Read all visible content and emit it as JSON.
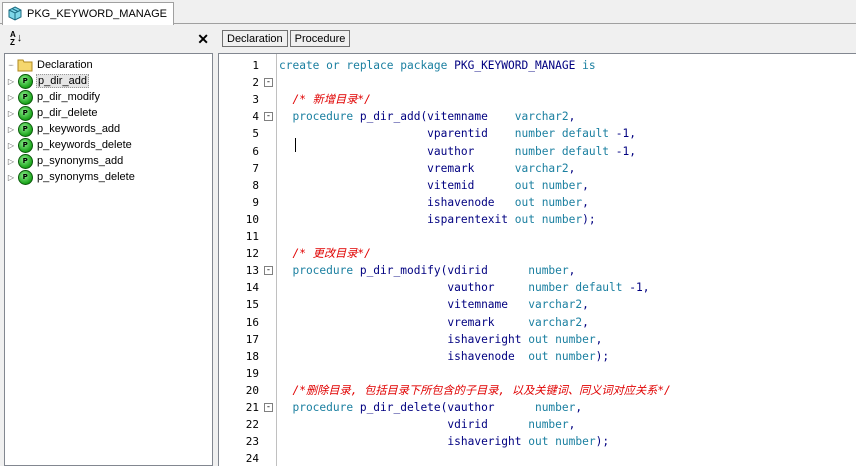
{
  "tab": {
    "title": "PKG_KEYWORD_MANAGE",
    "icon": "package-icon"
  },
  "left": {
    "sort_icon": "sort-az-icon",
    "close_icon": "close-icon",
    "tree": [
      {
        "label": "Declaration",
        "icon": "folder-icon",
        "expandable": false,
        "selected": false
      },
      {
        "label": "p_dir_add",
        "icon": "procedure-icon",
        "expandable": true,
        "selected": true
      },
      {
        "label": "p_dir_modify",
        "icon": "procedure-icon",
        "expandable": true,
        "selected": false
      },
      {
        "label": "p_dir_delete",
        "icon": "procedure-icon",
        "expandable": true,
        "selected": false
      },
      {
        "label": "p_keywords_add",
        "icon": "procedure-icon",
        "expandable": true,
        "selected": false
      },
      {
        "label": "p_keywords_delete",
        "icon": "procedure-icon",
        "expandable": true,
        "selected": false
      },
      {
        "label": "p_synonyms_add",
        "icon": "procedure-icon",
        "expandable": true,
        "selected": false
      },
      {
        "label": "p_synonyms_delete",
        "icon": "procedure-icon",
        "expandable": true,
        "selected": false
      }
    ],
    "procedure_badge": "P"
  },
  "right": {
    "buttons": [
      "Declaration",
      "Procedure"
    ],
    "colors": {
      "keyword": "#1a7fa0",
      "identifier": "#000080",
      "comment": "#e00000"
    },
    "lines": [
      {
        "n": "1",
        "fold": "",
        "segs": [
          [
            "kw",
            "create or replace package "
          ],
          [
            "id",
            "PKG_KEYWORD_MANAGE "
          ],
          [
            "kw",
            "is"
          ]
        ]
      },
      {
        "n": "2",
        "fold": "-",
        "segs": []
      },
      {
        "n": "3",
        "fold": "",
        "segs": [
          [
            "cm",
            "  /* 新增目录*/"
          ]
        ]
      },
      {
        "n": "4",
        "fold": "-",
        "segs": [
          [
            "kw",
            "  procedure "
          ],
          [
            "id",
            "p_dir_add(vitemname    "
          ],
          [
            "kw",
            "varchar2"
          ],
          [
            "id",
            ","
          ]
        ]
      },
      {
        "n": "5",
        "fold": "",
        "segs": [
          [
            "id",
            "                      vparentid    "
          ],
          [
            "kw",
            "number default "
          ],
          [
            "id",
            "-1,"
          ]
        ]
      },
      {
        "n": "6",
        "fold": "",
        "segs": [
          [
            "id",
            "                      vauthor      "
          ],
          [
            "kw",
            "number default "
          ],
          [
            "id",
            "-1,"
          ]
        ]
      },
      {
        "n": "7",
        "fold": "",
        "segs": [
          [
            "id",
            "                      vremark      "
          ],
          [
            "kw",
            "varchar2"
          ],
          [
            "id",
            ","
          ]
        ]
      },
      {
        "n": "8",
        "fold": "",
        "segs": [
          [
            "id",
            "                      vitemid      "
          ],
          [
            "kw",
            "out number"
          ],
          [
            "id",
            ","
          ]
        ]
      },
      {
        "n": "9",
        "fold": "",
        "segs": [
          [
            "id",
            "                      ishavenode   "
          ],
          [
            "kw",
            "out number"
          ],
          [
            "id",
            ","
          ]
        ]
      },
      {
        "n": "10",
        "fold": "",
        "segs": [
          [
            "id",
            "                      isparentexit "
          ],
          [
            "kw",
            "out number"
          ],
          [
            "id",
            ");"
          ]
        ]
      },
      {
        "n": "11",
        "fold": "",
        "segs": []
      },
      {
        "n": "12",
        "fold": "",
        "segs": [
          [
            "cm",
            "  /* 更改目录*/"
          ]
        ]
      },
      {
        "n": "13",
        "fold": "-",
        "segs": [
          [
            "kw",
            "  procedure "
          ],
          [
            "id",
            "p_dir_modify(vdirid      "
          ],
          [
            "kw",
            "number"
          ],
          [
            "id",
            ","
          ]
        ]
      },
      {
        "n": "14",
        "fold": "",
        "segs": [
          [
            "id",
            "                         vauthor     "
          ],
          [
            "kw",
            "number default "
          ],
          [
            "id",
            "-1,"
          ]
        ]
      },
      {
        "n": "15",
        "fold": "",
        "segs": [
          [
            "id",
            "                         vitemname   "
          ],
          [
            "kw",
            "varchar2"
          ],
          [
            "id",
            ","
          ]
        ]
      },
      {
        "n": "16",
        "fold": "",
        "segs": [
          [
            "id",
            "                         vremark     "
          ],
          [
            "kw",
            "varchar2"
          ],
          [
            "id",
            ","
          ]
        ]
      },
      {
        "n": "17",
        "fold": "",
        "segs": [
          [
            "id",
            "                         ishaveright "
          ],
          [
            "kw",
            "out number"
          ],
          [
            "id",
            ","
          ]
        ]
      },
      {
        "n": "18",
        "fold": "",
        "segs": [
          [
            "id",
            "                         ishavenode  "
          ],
          [
            "kw",
            "out number"
          ],
          [
            "id",
            ");"
          ]
        ]
      },
      {
        "n": "19",
        "fold": "",
        "segs": []
      },
      {
        "n": "20",
        "fold": "",
        "segs": [
          [
            "cm",
            "  /*删除目录, 包括目录下所包含的子目录, 以及关键词、同义词对应关系*/"
          ]
        ]
      },
      {
        "n": "21",
        "fold": "-",
        "segs": [
          [
            "kw",
            "  procedure "
          ],
          [
            "id",
            "p_dir_delete(vauthor      "
          ],
          [
            "kw",
            "number"
          ],
          [
            "id",
            ","
          ]
        ]
      },
      {
        "n": "22",
        "fold": "",
        "segs": [
          [
            "id",
            "                         vdirid      "
          ],
          [
            "kw",
            "number"
          ],
          [
            "id",
            ","
          ]
        ]
      },
      {
        "n": "23",
        "fold": "",
        "segs": [
          [
            "id",
            "                         ishaveright "
          ],
          [
            "kw",
            "out number"
          ],
          [
            "id",
            ");"
          ]
        ]
      },
      {
        "n": "24",
        "fold": "",
        "segs": []
      }
    ]
  }
}
